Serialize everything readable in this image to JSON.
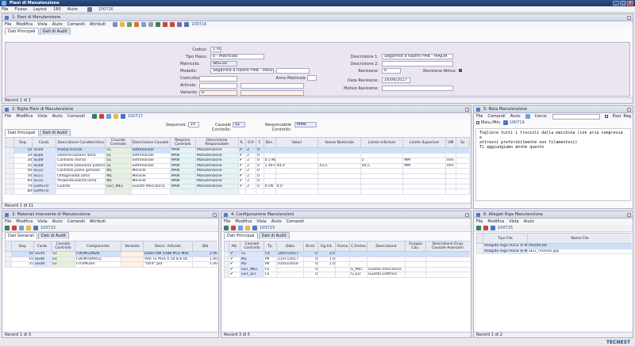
{
  "window": {
    "title": "Piani di Manutenzione",
    "user": "100716"
  },
  "menubar": [
    "File",
    "Flusso",
    "Layout",
    "180",
    "Aiuto"
  ],
  "main_panel": {
    "title": "1: Piani di Manutenzione",
    "menu": [
      "File",
      "Modifica",
      "Vista",
      "Aiuto",
      "Comandi",
      "Attributi"
    ],
    "code": "100716",
    "tabs": [
      "Dati Principali",
      "Dati di Audit"
    ],
    "fields": {
      "codice_label": "Codice:",
      "codice": "1.00",
      "tipo_label": "Tipo Piano:",
      "tipo": "0 - Matricola",
      "matricola_label": "Matricola:",
      "matricola": "SEG.02",
      "modello_label": "Modello:",
      "modello": "Segatrice a nastro FMB - MAXIR",
      "costruttore_label": "Costruttore:",
      "costruttore": "",
      "anno_label": "Anno Matricola",
      "articolo_label": "Articolo:",
      "articolo": "",
      "variante_label": "Variante:",
      "variante": "0",
      "desc1_label": "Descrizione 1:",
      "desc1": "Segatrice a nastro FMB - MAJOR",
      "desc2_label": "Descrizione 2:",
      "desc2": "",
      "revisione_label": "Revisione:",
      "revisione": "0",
      "revattiva_label": "Revisione Attiva:",
      "datarev_label": "Data Revisione:",
      "datarev": "16/06/2017",
      "motivo_label": "Motivo Revisione:",
      "motivo": ""
    },
    "status": "Record 1 di 1"
  },
  "righe_panel": {
    "title": "2: Righe Piani di Manutenzione",
    "menu": [
      "File",
      "Modifica",
      "Vista",
      "Aiuto",
      "Comandi"
    ],
    "code": "100717",
    "sequenza_label": "Sequenza:",
    "sequenza": "10",
    "causale_label": "Causale Controllo:",
    "causale": "S1",
    "responsabile_label": "Responsabile Controllo:",
    "responsabile": "MAN",
    "tabs": [
      "Dati Principali",
      "Dati di Audit"
    ],
    "columns": [
      "Seq.",
      "Carat.",
      "Descrizione Caratteristica",
      "Causale Controllo",
      "Descrizione Causale",
      "Respons. Controllo",
      "Descrizione Responsabile",
      "R.",
      "O.P.",
      "F.",
      "Dec.",
      "Valori",
      "Valore Nominale",
      "Limite Inferiore",
      "Limite Superiore",
      "UM",
      "Sc"
    ],
    "rows": [
      [
        "10",
        "SG04",
        "Pulizia trucioli",
        "S1",
        "Settimanale",
        "MAN",
        "Manutenzione",
        "✔",
        "2",
        "0",
        "",
        "",
        "",
        "",
        "",
        "",
        ""
      ],
      [
        "20",
        "SG06",
        "Determinazione lama",
        "S1",
        "Settimanale",
        "MAN",
        "Manutenzione",
        "✔",
        "2",
        "0",
        "",
        "",
        "",
        "",
        "",
        "",
        ""
      ],
      [
        "30",
        "SG09",
        "Controllo morsa",
        "S1",
        "Settimanale",
        "MAN",
        "Manutenzione",
        "✔",
        "2",
        "0",
        "0.5 MAX",
        "",
        "",
        "5",
        "MM",
        "mm",
        ""
      ],
      [
        "35",
        "SG08",
        "Controllo posizione pistone",
        "S1",
        "Settimanale",
        "MAN",
        "Manutenzione",
        "✔",
        "2",
        "0",
        "1 44+-0,5",
        "44,0",
        "43,5",
        "44,5",
        "MM",
        "mm",
        ""
      ],
      [
        "40",
        "SG12",
        "Controllo piano girevole",
        "M1",
        "Mensile",
        "MAN",
        "Manutenzione",
        "✔",
        "2",
        "0",
        "",
        "",
        "",
        "",
        "",
        "",
        ""
      ],
      [
        "50",
        "SG11",
        "Ortogonalità lama",
        "M1",
        "Mensile",
        "MAN",
        "Manutenzione",
        "✔",
        "2",
        "0",
        "",
        "",
        "",
        "",
        "",
        "",
        ""
      ],
      [
        "60",
        "SG15",
        "Perpendicolarità lama",
        "M1",
        "Mensile",
        "MAN",
        "Manutenzione",
        "✔",
        "2",
        "0",
        "",
        "",
        "",
        "",
        "",
        "",
        ""
      ],
      [
        "70",
        "GUASTO",
        "Guasto",
        "GST_MEC",
        "Guasto Meccanico",
        "MAN",
        "Manutenzione",
        "✔",
        "2",
        "0",
        "0 OK",
        "0,0",
        "",
        "",
        "",
        "",
        ""
      ],
      [
        "80",
        "GUASTO",
        "",
        "",
        "",
        "",
        "",
        "",
        "",
        "",
        "",
        "",
        "",
        "",
        "",
        "",
        ""
      ]
    ],
    "status": "Record 1 di 11"
  },
  "note_panel": {
    "title": "5: Nota Manutenzione",
    "menu": [
      "File",
      "Comandi",
      "Aiuto"
    ],
    "cerca_label": "Cerca:",
    "espr_label": "Espr. Reg.",
    "maiu_label": "Maiu./Min.",
    "code": "100719",
    "text": [
      "Togliere tutti i trucioli dalla macchina (con aria compressa e",
      "attrezzi preferibilmente non filamentosi)",
      "Ti aggiungiamo anche questo"
    ]
  },
  "materiali_panel": {
    "title": "3: Materiali Intervento di Manutenzione",
    "menu": [
      "File",
      "Modifica",
      "Vista",
      "Aiuto",
      "Comandi",
      "Attributi"
    ],
    "code": "100722",
    "tabs": [
      "Dati Generali",
      "Dati di Audit"
    ],
    "columns": [
      "Seq.",
      "Carat.",
      "Causale Controllo",
      "Componente",
      "Variante",
      "Descr. Articolo",
      "Qtà"
    ],
    "rows": [
      [
        "10",
        "SG04",
        "S1",
        "FDOM12MZB",
        "",
        "Dado UNI 5588 M12 Mez",
        "2.00"
      ],
      [
        "10",
        "SG06",
        "S1",
        "FDOM16M45Z",
        "",
        "Vite TE M16 X 50 8.8 DC",
        "1.00"
      ],
      [
        "35",
        "SG08",
        "S1",
        "FFOPN160",
        "",
        "\"Ufrit\" Jod",
        "1.00"
      ]
    ],
    "status": "Record 1 di 3"
  },
  "config_panel": {
    "title": "4: Configurazione Manutenzioni",
    "menu": [
      "File",
      "Modifica",
      "Vista",
      "Aiuto",
      "Comandi"
    ],
    "code": "100723",
    "tabs": [
      "Dati Principali",
      "Dati di Audit"
    ],
    "columns": [
      "Att.",
      "Causale Controllo",
      "Tp.",
      "Data",
      "N.Int.",
      "Gg.Int.",
      "Fermo",
      "C.Fermo",
      "Descrizione",
      "Gruppo Cau.",
      "Descrizione Grup. Causale Avanzam."
    ],
    "rows": [
      [
        "✔",
        "S1",
        "FR",
        "26/07/2017",
        "0",
        "3.0",
        "",
        "",
        "",
        "",
        ""
      ],
      [
        "✔",
        "M1",
        "MI",
        "21/07/2017",
        "0",
        "1.0",
        "",
        "",
        "",
        "",
        ""
      ],
      [
        "✔",
        "M2",
        "MI",
        "02/02/2016",
        "0",
        "1.0",
        "",
        "",
        "",
        "",
        ""
      ],
      [
        "✔",
        "GST_MEC",
        "FE",
        "-",
        "0",
        "",
        "",
        "G_MEC",
        "Guasto meccanico",
        "",
        ""
      ],
      [
        "✔",
        "GST_ELT",
        "FE",
        "-",
        "0",
        "",
        "",
        "G_ELT",
        "Guasto Elettrico",
        "",
        ""
      ]
    ],
    "status": "Record 3 di 5"
  },
  "allegati_panel": {
    "title": "6: Allegati Riga Manutenzione",
    "menu": [
      "File",
      "Modifica",
      "Vista",
      "Aiuto"
    ],
    "code": "100725",
    "columns": [
      "Tipo File",
      "Nome File"
    ],
    "rows": [
      [
        "Allegato Riga Piano di Man",
        "PROVA.txt"
      ],
      [
        "Allegato Riga Piano di Man",
        "SEG_Thomas.jpg"
      ]
    ],
    "status": "Record 1 di 2"
  },
  "brand": "TECNEST"
}
